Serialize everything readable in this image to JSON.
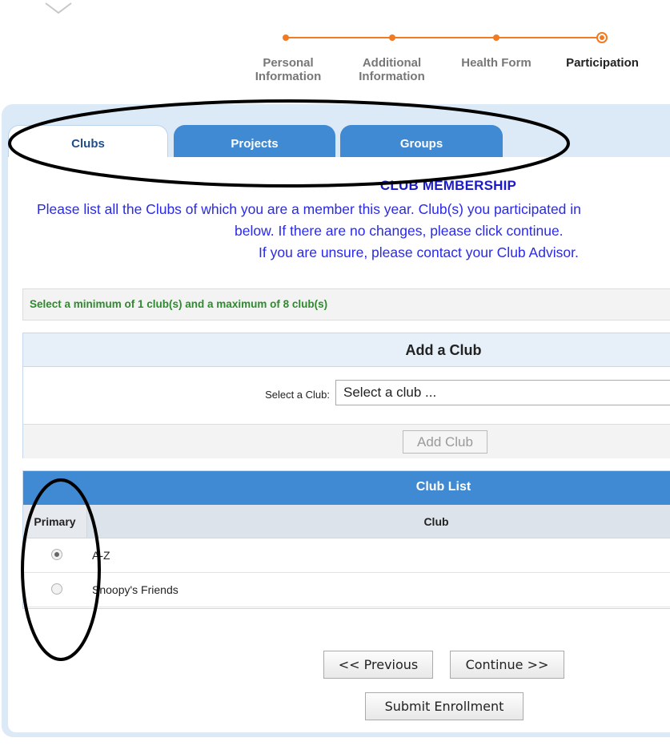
{
  "stepper": {
    "steps": [
      {
        "label": "Personal\nInformation",
        "state": "completed"
      },
      {
        "label": "Additional\nInformation",
        "state": "completed"
      },
      {
        "label": "Health Form",
        "state": "completed"
      },
      {
        "label": "Participation",
        "state": "current"
      }
    ],
    "accent_color": "#f07b22"
  },
  "tabs": [
    {
      "label": "Clubs",
      "active": true
    },
    {
      "label": "Projects",
      "active": false
    },
    {
      "label": "Groups",
      "active": false
    }
  ],
  "membership": {
    "title": "CLUB MEMBERSHIP",
    "intro_line1": "Please list all the Clubs of which you are a member this year. Club(s) you participated in",
    "intro_line2": "below.  If there are no changes, please click continue.",
    "intro_line3": "If you are unsure, please contact your Club Advisor."
  },
  "requirement": "Select a minimum of 1 club(s) and a maximum of 8 club(s)",
  "add_club": {
    "title": "Add a Club",
    "select_label": "Select a Club:",
    "select_value": "Select a club ...",
    "button_label": "Add Club"
  },
  "club_list": {
    "title": "Club List",
    "col_primary": "Primary",
    "col_club": "Club",
    "rows": [
      {
        "name": "A-Z",
        "primary": true
      },
      {
        "name": "Snoopy's Friends",
        "primary": false
      }
    ]
  },
  "nav": {
    "previous_label": "<< Previous",
    "continue_label": "Continue >>",
    "submit_label": "Submit Enrollment"
  },
  "colors": {
    "tab_blue": "#3f8ad2",
    "panel_bg": "#dce9f7",
    "intro_text": "#2a2ae6",
    "requirement_text": "#2f8a2f"
  }
}
